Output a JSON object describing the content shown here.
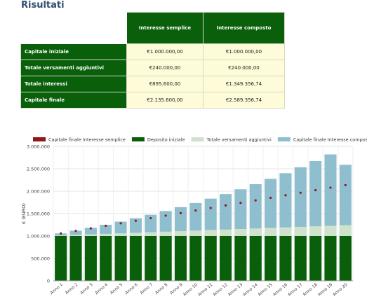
{
  "page": {
    "title": "Risultati"
  },
  "table": {
    "headers": [
      "",
      "Interesse semplice",
      "Interesse composto"
    ],
    "rows": [
      {
        "label": "Capitale iniziale",
        "semplice": "€1.000.000,00",
        "composto": "€1.000.000,00"
      },
      {
        "label": "Totale versamenti aggiuntivi",
        "semplice": "€240.000,00",
        "composto": "€240.000,00"
      },
      {
        "label": "Totale interessi",
        "semplice": "€895.600,00",
        "composto": "€1.349.356,74"
      },
      {
        "label": "Capitale finale",
        "semplice": "€2.135.600,00",
        "composto": "€2.589.356,74"
      }
    ]
  },
  "chart_data": {
    "type": "bar",
    "stacked": true,
    "title": "",
    "xlabel": "",
    "ylabel": "€ (EURO)",
    "ylim": [
      0,
      3000000
    ],
    "yticks": [
      0,
      500000,
      1000000,
      1500000,
      2000000,
      2500000,
      3000000
    ],
    "ytick_labels": [
      "0",
      "500.000",
      "1.000.000",
      "1.500.000",
      "2.000.000",
      "2.500.000",
      "3.000.000"
    ],
    "grid": true,
    "legend_position": "top",
    "categories": [
      "Anno 1",
      "Anno 2",
      "Anno 3",
      "Anno 4",
      "Anno 5",
      "Anno 6",
      "Anno 7",
      "Anno 8",
      "Anno 9",
      "Anno 10",
      "Anno 11",
      "Anno 12",
      "Anno 13",
      "Anno 14",
      "Anno 15",
      "Anno 16",
      "Anno 17",
      "Anno 18",
      "Anno 19",
      "Anno 20"
    ],
    "series": [
      {
        "name": "Capitale finale Interesse semplice",
        "kind": "dot",
        "color": "#8b1a1a",
        "values": [
          1056780,
          1113560,
          1170340,
          1227120,
          1283900,
          1340680,
          1397460,
          1454240,
          1511020,
          1567800,
          1624580,
          1681360,
          1738140,
          1794920,
          1851700,
          1908480,
          1965260,
          2022040,
          2078820,
          2135600
        ]
      },
      {
        "name": "Deposito iniziale",
        "kind": "bar",
        "color": "#0a5f0a",
        "values": [
          1000000,
          1000000,
          1000000,
          1000000,
          1000000,
          1000000,
          1000000,
          1000000,
          1000000,
          1000000,
          1000000,
          1000000,
          1000000,
          1000000,
          1000000,
          1000000,
          1000000,
          1000000,
          1000000,
          1000000
        ]
      },
      {
        "name": "Totale versamenti aggiuntivi",
        "kind": "bar",
        "color": "#cfe3cc",
        "values": [
          12000,
          24000,
          36000,
          48000,
          60000,
          72000,
          84000,
          96000,
          108000,
          120000,
          132000,
          144000,
          156000,
          168000,
          180000,
          192000,
          204000,
          216000,
          228000,
          240000
        ]
      },
      {
        "name": "Capitale finale Interesse composto",
        "kind": "bar",
        "color": "#8fbfcf",
        "values": [
          1057600,
          1118300,
          1182300,
          1249600,
          1320500,
          1395200,
          1473900,
          1556800,
          1644100,
          1736100,
          1833000,
          1935100,
          2042600,
          2155900,
          2275200,
          2400900,
          2533300,
          2672800,
          2819700,
          2589356
        ]
      }
    ]
  }
}
